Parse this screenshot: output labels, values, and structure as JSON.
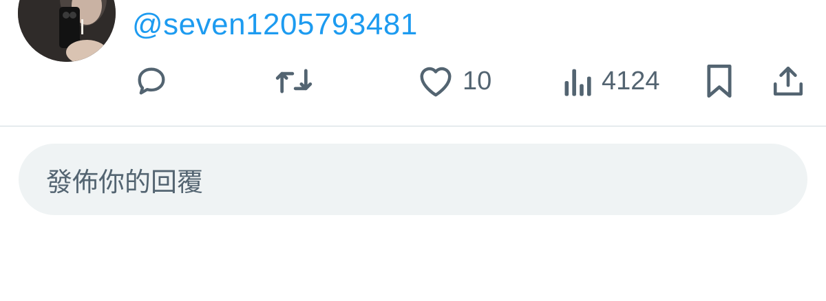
{
  "tweet": {
    "handle": "@seven1205793481",
    "avatar_icon": "user-avatar-photo"
  },
  "actions": {
    "reply": {
      "icon": "reply-icon",
      "count": ""
    },
    "retweet": {
      "icon": "retweet-icon",
      "count": ""
    },
    "like": {
      "icon": "heart-icon",
      "count": "10"
    },
    "views": {
      "icon": "views-chart-icon",
      "count": "4124"
    },
    "bookmark": {
      "icon": "bookmark-icon"
    },
    "share": {
      "icon": "share-icon"
    }
  },
  "reply_box": {
    "placeholder": "發佈你的回覆"
  },
  "colors": {
    "handle": "#1d9bf0",
    "icon_gray": "#536471",
    "divider": "#cfd9de",
    "reply_bg": "#eff3f4"
  }
}
